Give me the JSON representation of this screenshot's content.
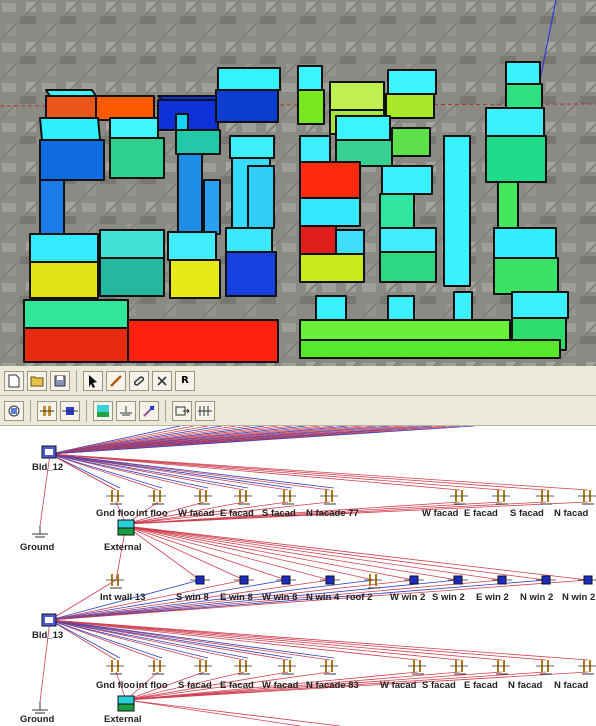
{
  "toolbar1": {
    "buttons": [
      {
        "name": "new-doc-icon"
      },
      {
        "name": "open-folder-icon"
      },
      {
        "name": "save-icon"
      },
      {
        "name": "pointer-icon"
      },
      {
        "name": "pencil-icon"
      },
      {
        "name": "link-icon"
      },
      {
        "name": "delete-icon"
      },
      {
        "name": "r-button",
        "label": "R"
      }
    ]
  },
  "toolbar2": {
    "buttons": [
      {
        "name": "model-icon"
      },
      {
        "name": "wall-icon"
      },
      {
        "name": "node-icon"
      },
      {
        "name": "surface-icon"
      },
      {
        "name": "ground-tool-icon"
      },
      {
        "name": "window-tool-icon"
      },
      {
        "name": "export-icon"
      },
      {
        "name": "table-icon"
      }
    ]
  },
  "network": {
    "block1": {
      "building": "Bld_12",
      "surfaces": [
        "Gnd floo",
        "int floo",
        "W facad",
        "E facad",
        "S facad",
        "N facade 77",
        "W facad",
        "E facad",
        "S facad",
        "N facad"
      ],
      "ground": "Ground",
      "external": "External"
    },
    "block2": {
      "building": "Bld_13",
      "top_row": [
        "Int wall 13",
        "S win",
        "E win",
        "W win",
        "N win",
        "roof 2",
        "W win",
        "S win",
        "E win",
        "N win",
        "N win"
      ],
      "top_row_labels": [
        "Int wall 13",
        "S win 8",
        "E win 8",
        "W win 8",
        "N win 4",
        "roof 2",
        "W win 2",
        "S win 2",
        "E win 2",
        "N win 2",
        "N win 2"
      ],
      "surfaces": [
        "Gnd floo",
        "int floo",
        "S facad",
        "E facad",
        "W facad",
        "N facade 83",
        "W facad",
        "S facad",
        "E facad",
        "N facad",
        "N facad"
      ],
      "ground": "Ground",
      "external": "External"
    }
  }
}
